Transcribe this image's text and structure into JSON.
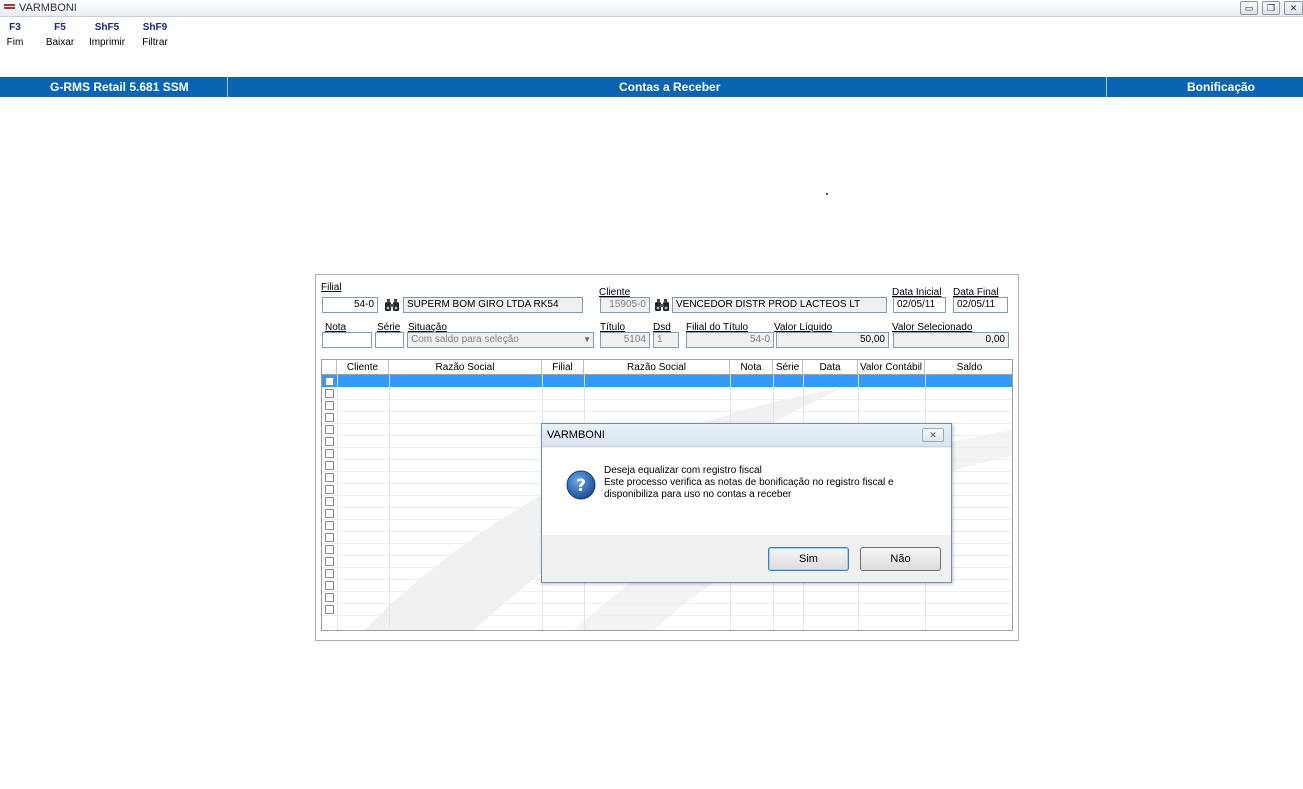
{
  "window": {
    "title": "VARMBONI",
    "buttons": [
      "minimize-icon",
      "restore-icon",
      "close-icon"
    ]
  },
  "toolbar": [
    {
      "key": "F3",
      "label": "Fim"
    },
    {
      "key": "F5",
      "label": "Baixar"
    },
    {
      "key": "ShF5",
      "label": "Imprimir"
    },
    {
      "key": "ShF9",
      "label": "Filtrar"
    }
  ],
  "header_bar": {
    "product": "G-RMS Retail 5.681 SSM",
    "module": "Contas a Receber",
    "section": "Bonificação",
    "color": "#0a64b4"
  },
  "form": {
    "filial_label": "Filial",
    "filial_value": "54-0",
    "filial_name": "SUPERM BOM GIRO LTDA RK54",
    "cliente_label": "Cliente",
    "cliente_value": "15905-0",
    "cliente_name": "VENCEDOR DISTR PROD LACTEOS LT",
    "data_inicial_label": "Data Inicial",
    "data_inicial_value": "02/05/11",
    "data_final_label": "Data Final",
    "data_final_value": "02/05/11",
    "nota_label": "Nota",
    "nota_value": "",
    "serie_label": "Série",
    "serie_value": "",
    "situacao_label": "Situação",
    "situacao_value": "Com saldo para seleção",
    "titulo_label": "Título",
    "titulo_value": "5104",
    "dsd_label": "Dsd",
    "dsd_value": "1",
    "filial_titulo_label": "Filial do Título",
    "filial_titulo_value": "54-0",
    "valor_liquido_label": "Valor Líquido",
    "valor_liquido_value": "50,00",
    "valor_selecionado_label": "Valor Selecionado",
    "valor_selecionado_value": "0,00"
  },
  "grid": {
    "columns": [
      "Cliente",
      "Razão Social",
      "Filial",
      "Razão Social",
      "Nota",
      "Série",
      "Data",
      "Valor Contábil",
      "Saldo"
    ],
    "row_count": 20,
    "selection_color": "#3399ff"
  },
  "dialog": {
    "title": "VARMBONI",
    "icon": "question-icon",
    "message_lines": [
      "Deseja equalizar com registro fiscal",
      "Este processo verifica as notas de bonificação no registro fiscal e",
      "disponibiliza para uso no contas a receber"
    ],
    "yes_label": "Sim",
    "no_label": "Não"
  }
}
